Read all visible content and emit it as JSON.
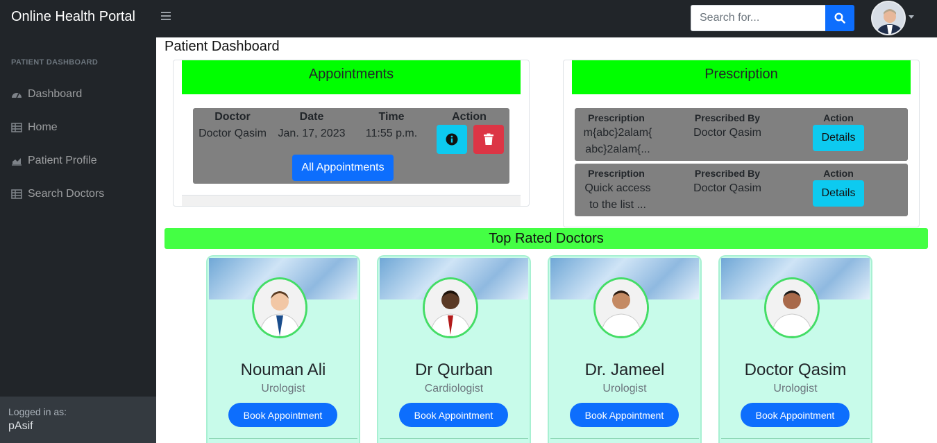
{
  "app": {
    "brand": "Online Health Portal"
  },
  "search": {
    "placeholder": "Search for..."
  },
  "sidebar": {
    "heading": "PATIENT DASHBOARD",
    "items": [
      {
        "label": "Dashboard",
        "icon": "dashboard-gauge-icon"
      },
      {
        "label": "Home",
        "icon": "table-icon"
      },
      {
        "label": "Patient Profile",
        "icon": "chart-area-icon"
      },
      {
        "label": "Search Doctors",
        "icon": "table-icon"
      }
    ],
    "footer": {
      "label": "Logged in as:",
      "user": "pAsif"
    }
  },
  "main": {
    "title": "Patient Dashboard",
    "appointments": {
      "header": "Appointments",
      "columns": [
        "Doctor",
        "Date",
        "Time",
        "Action"
      ],
      "rows": [
        {
          "doctor": "Doctor Qasim",
          "date": "Jan. 17, 2023",
          "time": "11:55 p.m."
        }
      ],
      "all_button": "All Appointments"
    },
    "prescription": {
      "header": "Prescription",
      "columns": [
        "Prescription",
        "Prescribed By",
        "Action"
      ],
      "rows": [
        {
          "line1": "m{abc}2alam{",
          "line2": "abc}2alam{...",
          "by": "Doctor Qasim",
          "action": "Details"
        },
        {
          "line1": "Quick access",
          "line2": "to the list ...",
          "by": "Doctor Qasim",
          "action": "Details"
        }
      ]
    },
    "top_rated": {
      "header": "Top Rated Doctors",
      "doctors": [
        {
          "name": "Nouman Ali",
          "specialty": "Urologist",
          "button": "Book Appointment"
        },
        {
          "name": "Dr Qurban",
          "specialty": "Cardiologist",
          "button": "Book Appointment"
        },
        {
          "name": "Dr. Jameel",
          "specialty": "Urologist",
          "button": "Book Appointment"
        },
        {
          "name": "Doctor Qasim",
          "specialty": "Urologist",
          "button": "Book Appointment"
        }
      ]
    }
  },
  "colors": {
    "navbar": "#212529",
    "header_green": "#00ff00",
    "top_rated_green": "#44ff44",
    "card_mint": "#c8fbea",
    "primary": "#0d6efd",
    "info": "#0dcaf0",
    "danger": "#dc3545"
  }
}
